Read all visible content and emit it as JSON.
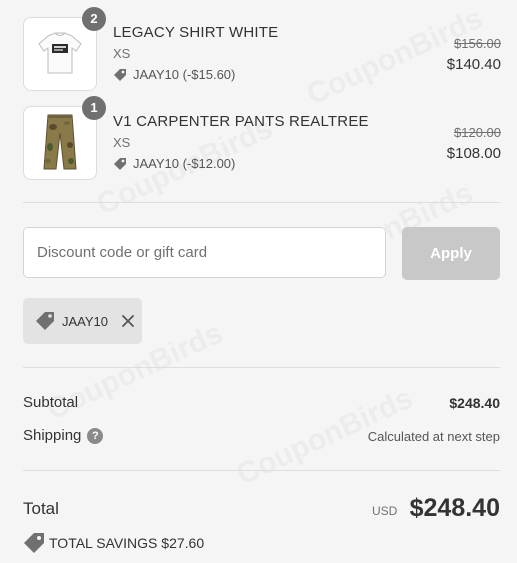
{
  "watermark": "CouponBirds",
  "items": [
    {
      "quantity": "2",
      "title": "LEGACY SHIRT WHITE",
      "variant": "XS",
      "discount": "JAAY10 (-$15.60)",
      "original_price": "$156.00",
      "price": "$140.40",
      "image_icon": "white-shirt-image"
    },
    {
      "quantity": "1",
      "title": "V1 CARPENTER PANTS REALTREE",
      "variant": "XS",
      "discount": "JAAY10 (-$12.00)",
      "original_price": "$120.00",
      "price": "$108.00",
      "image_icon": "camo-pants-image"
    }
  ],
  "discount_form": {
    "placeholder": "Discount code or gift card",
    "value": "",
    "apply_label": "Apply"
  },
  "applied_code": {
    "label": "JAAY10",
    "icon": "tag-icon",
    "remove_icon": "close-icon"
  },
  "summary": {
    "subtotal_label": "Subtotal",
    "subtotal_value": "$248.40",
    "shipping_label": "Shipping",
    "shipping_help": "?",
    "shipping_value": "Calculated at next step"
  },
  "total": {
    "label": "Total",
    "currency": "USD",
    "amount": "$248.40",
    "savings": "TOTAL SAVINGS $27.60"
  },
  "colors": {
    "background": "#f5f5f5",
    "badge": "#707070",
    "apply_disabled": "#c8c8c8",
    "tag_background": "#e3e3e3"
  }
}
